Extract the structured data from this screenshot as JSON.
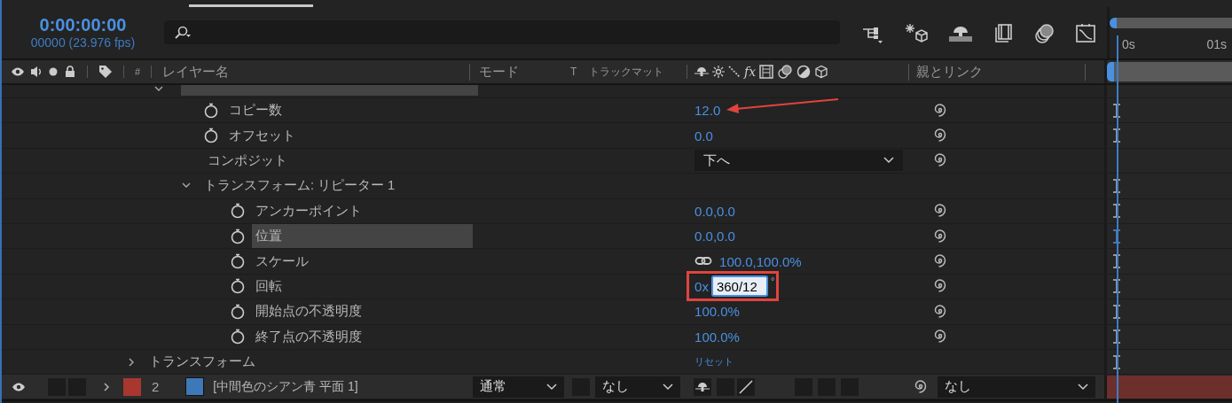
{
  "timecode": "0:00:00:00",
  "frame_info": "00000 (23.976 fps)",
  "columns": {
    "effects": "fx",
    "name": "レイヤー名",
    "mode": "モード",
    "t": "T",
    "track_matte": "トラックマット",
    "parent": "親とリンク",
    "number": "#"
  },
  "timeline": {
    "ticks": [
      "0s",
      "01s"
    ]
  },
  "repeater": {
    "expanded": true,
    "children": [
      {
        "label": "コピー数",
        "kind": "value",
        "value": "12.0",
        "selected": false
      },
      {
        "label": "オフセット",
        "kind": "value",
        "value": "0.0",
        "selected": false
      },
      {
        "label": "コンポジット",
        "kind": "dropdown",
        "value": "下へ",
        "selected": false
      },
      {
        "label": "トランスフォーム: リピーター 1",
        "expanded": true,
        "children": [
          {
            "label": "アンカーポイント",
            "kind": "value",
            "value": "0.0,0.0",
            "selected": false
          },
          {
            "label": "位置",
            "kind": "value",
            "value": "0.0,0.0",
            "selected": true
          },
          {
            "label": "スケール",
            "kind": "linked_value",
            "value": "100.0,100.0%",
            "selected": false
          },
          {
            "label": "回転",
            "kind": "editing",
            "prefix": "0x",
            "value": "360/12",
            "suffix": "°",
            "selected": false
          },
          {
            "label": "開始点の不透明度",
            "kind": "value",
            "value": "100.0%",
            "selected": false
          },
          {
            "label": "終了点の不透明度",
            "kind": "value",
            "value": "100.0%",
            "selected": false
          }
        ]
      }
    ]
  },
  "transform": {
    "label": "トランスフォーム",
    "expanded": false,
    "value": "リセット"
  },
  "layer": {
    "visible": true,
    "expanded": false,
    "label": {
      "color": "#a8372f"
    },
    "number": "2",
    "source": {
      "color": "#3f78b8"
    },
    "name": "[中間色のシアン青 平面 1]",
    "mode": "通常",
    "track_matte": "なし",
    "parent": "なし"
  }
}
